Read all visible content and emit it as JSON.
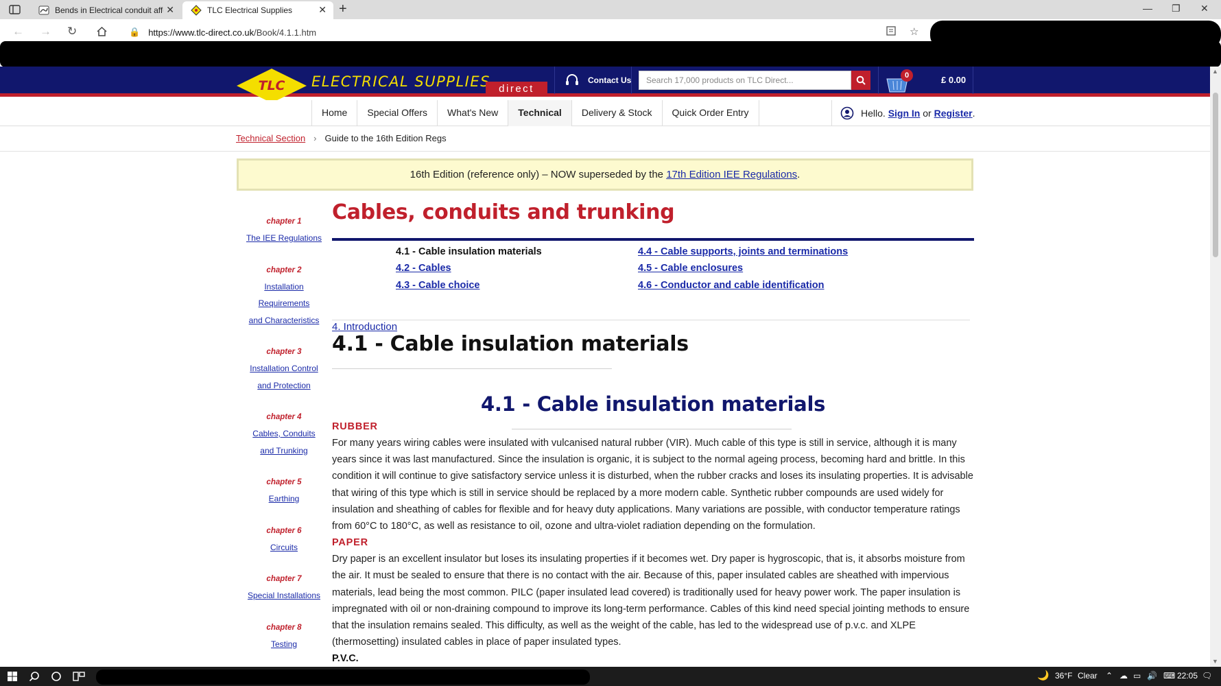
{
  "browser": {
    "tabs": [
      {
        "title": "Bends in Electrical conduit affect",
        "close": "✕"
      },
      {
        "title": "TLC Electrical Supplies",
        "close": "✕"
      }
    ],
    "new_tab": "+",
    "url_scheme_host": "https://www.tlc-direct.co.uk",
    "url_path": "/Book/4.1.1.htm"
  },
  "site": {
    "logo_text": "TLC",
    "brand": "ELECTRICAL SUPPLIES",
    "brand_sub": "direct",
    "contact": "Contact Us",
    "search_placeholder": "Search 17,000 products on TLC Direct...",
    "cart_count": "0",
    "cart_total": "£ 0.00",
    "colors": {
      "header": "#11176d",
      "accent": "#c0202c",
      "logo": "#f4de00",
      "link": "#1a2aa8"
    }
  },
  "nav": {
    "items": [
      "Home",
      "Special Offers",
      "What's New",
      "Technical",
      "Delivery & Stock",
      "Quick Order Entry"
    ],
    "active": "Technical",
    "greeting": "Hello.",
    "sign_in": "Sign In",
    "or": "or",
    "register": "Register",
    "period": "."
  },
  "breadcrumb": {
    "section": "Technical Section",
    "separator": "›",
    "current": "Guide to the 16th Edition Regs"
  },
  "notice": {
    "text": "16th Edition (reference only) – NOW superseded by the",
    "link": "17th Edition IEE Regulations",
    "end": "."
  },
  "chapters": [
    {
      "label": "chapter 1",
      "title_lines": [
        "The IEE Regulations"
      ]
    },
    {
      "label": "chapter 2",
      "title_lines": [
        "Installation",
        "Requirements",
        "and Characteristics"
      ]
    },
    {
      "label": "chapter 3",
      "title_lines": [
        "Installation Control",
        "and Protection"
      ]
    },
    {
      "label": "chapter 4",
      "title_lines": [
        "Cables, Conduits",
        "and Trunking"
      ]
    },
    {
      "label": "chapter 5",
      "title_lines": [
        "Earthing"
      ]
    },
    {
      "label": "chapter 6",
      "title_lines": [
        "Circuits"
      ]
    },
    {
      "label": "chapter 7",
      "title_lines": [
        "Special Installations"
      ]
    },
    {
      "label": "chapter 8",
      "title_lines": [
        "Testing"
      ]
    }
  ],
  "content": {
    "title": "Cables, conduits and trunking",
    "toc_left": [
      {
        "text": "4.1 - Cable insulation materials",
        "current": true
      },
      {
        "text": "4.2 - Cables",
        "current": false
      },
      {
        "text": "4.3 - Cable choice",
        "current": false
      }
    ],
    "toc_right": [
      {
        "text": "4.4 - Cable supports, joints and terminations",
        "current": false
      },
      {
        "text": "4.5 - Cable enclosures",
        "current": false
      },
      {
        "text": "4.6 - Conductor and cable identification",
        "current": false
      }
    ],
    "intro_link": "4. Introduction",
    "heading": "4.1 - Cable insulation materials",
    "subheading": "4.1 - Cable insulation materials",
    "sections": [
      {
        "title": "RUBBER",
        "text": "For many years wiring cables were insulated with vulcanised natural rubber (VIR). Much cable of this type is still in service, although it is many years since it was last manufactured. Since the insulation is organic, it is subject to the normal ageing process, becoming hard and brittle. In this condition it will continue to give satisfactory service unless it is disturbed, when the rubber cracks and loses its insulating properties. It is advisable that wiring of this type which is still in service should be replaced by a more modern cable. Synthetic rubber compounds are used widely for insulation and sheathing of cables for flexible and for heavy duty applications. Many variations are possible, with conductor temperature ratings from 60°C to 180°C, as well as resistance to oil, ozone and ultra-violet radiation depending on the formulation."
      },
      {
        "title": "PAPER",
        "text": "Dry paper is an excellent insulator but loses its insulating properties if it becomes wet. Dry paper is hygroscopic, that is, it absorbs moisture from the air. It must be sealed to ensure that there is no contact with the air. Because of this, paper insulated cables are sheathed with impervious materials, lead being the most common. PILC (paper insulated lead covered) is traditionally used for heavy power work. The paper insulation is impregnated with oil or non-draining compound to improve its long-term performance. Cables of this kind need special jointing methods to ensure that the insulation remains sealed. This difficulty, as well as the weight of the cable, has led to the widespread use of p.v.c. and XLPE (thermosetting) insulated cables in place of paper insulated types."
      },
      {
        "title": "P.V.C.",
        "text": ""
      }
    ]
  },
  "taskbar": {
    "temperature": "36°F",
    "weather": "Clear",
    "time": "22:05"
  }
}
